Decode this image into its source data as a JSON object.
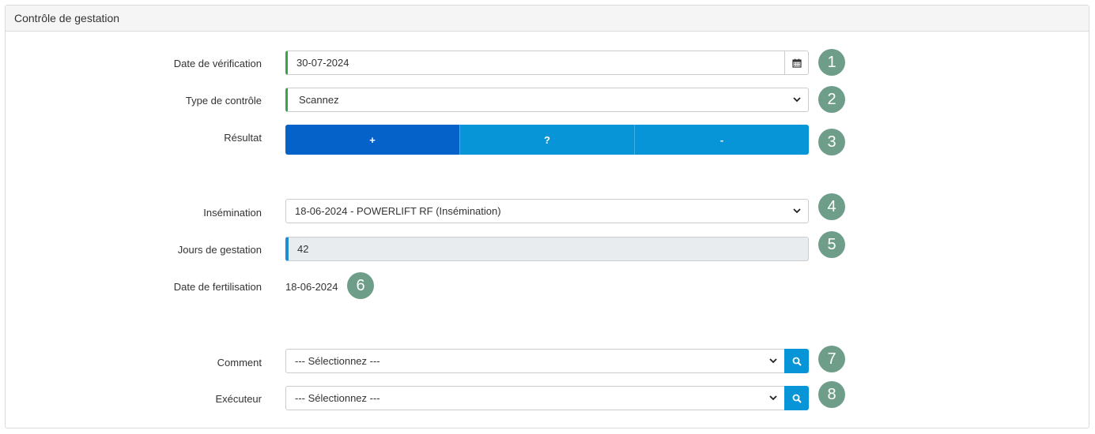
{
  "panel": {
    "title": "Contrôle de gestation"
  },
  "fields": {
    "verification_date": {
      "label": "Date de vérification",
      "value": "30-07-2024"
    },
    "control_type": {
      "label": "Type de contrôle",
      "value": "Scannez"
    },
    "result": {
      "label": "Résultat",
      "options": [
        "+",
        "?",
        "-"
      ],
      "selected": "+"
    },
    "insemination": {
      "label": "Insémination",
      "value": "18-06-2024 - POWERLIFT RF (Insémination)"
    },
    "gestation_days": {
      "label": "Jours de gestation",
      "value": "42"
    },
    "fertilization_date": {
      "label": "Date de fertilisation",
      "value": "18-06-2024"
    },
    "comment": {
      "label": "Comment",
      "value": "--- Sélectionnez ---"
    },
    "executor": {
      "label": "Exécuteur",
      "value": "--- Sélectionnez ---"
    }
  },
  "badges": [
    "1",
    "2",
    "3",
    "4",
    "5",
    "6",
    "7",
    "8"
  ],
  "icons": {
    "calendar": "calendar-icon",
    "caret": "chevron-down-icon",
    "search": "search-icon"
  },
  "colors": {
    "accent_green": "#3aa34a",
    "accent_blue": "#1d8ed6",
    "button_blue": "#0795d8",
    "button_active": "#0462c9",
    "badge": "#6e9e8a"
  }
}
